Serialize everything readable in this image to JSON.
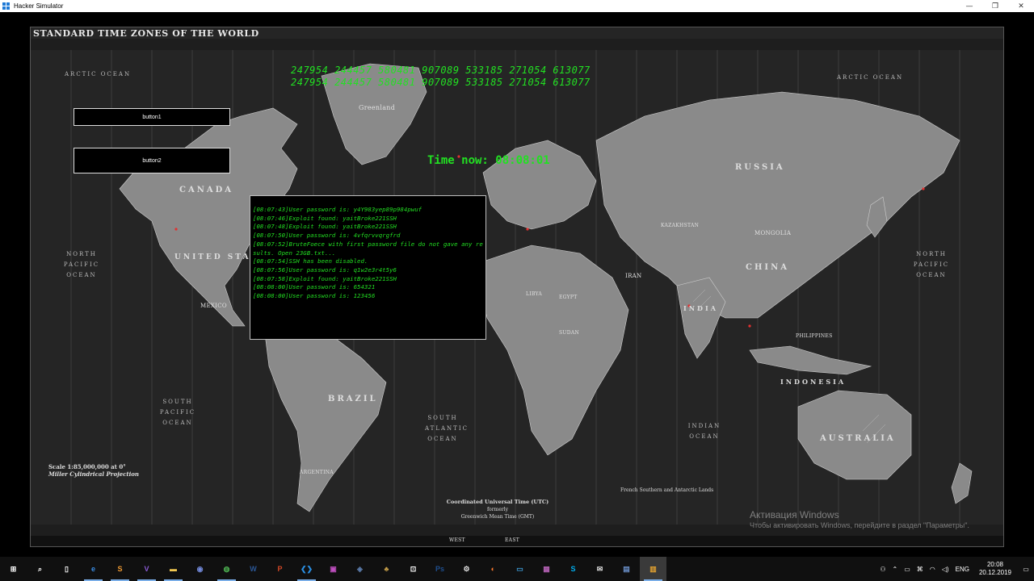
{
  "window": {
    "title": "Hacker Simulator",
    "minimize_glyph": "—",
    "maximize_glyph": "❐",
    "close_glyph": "✕"
  },
  "map": {
    "title": "STANDARD TIME ZONES OF THE WORLD",
    "labels": {
      "russia": "RUSSIA",
      "canada": "CANADA",
      "united_states": "UNITED STATES",
      "china": "CHINA",
      "india": "INDIA",
      "brazil": "BRAZIL",
      "australia": "AUSTRALIA",
      "indonesia": "INDONESIA",
      "mongolia": "MONGOLIA",
      "kazakhstan": "KAZAKHSTAN",
      "greenland": "Greenland",
      "mexico": "MEXICO",
      "argentina": "ARGENTINA",
      "libya": "LIBYA",
      "egypt": "EGYPT",
      "iran": "IRAN",
      "sudan": "SUDAN",
      "philippines": "PHILIPPINES"
    },
    "oceans": {
      "arctic_left": "ARCTIC OCEAN",
      "arctic_right": "ARCTIC OCEAN",
      "north_pacific_left": "NORTH PACIFIC OCEAN",
      "north_pacific_right": "NORTH PACIFIC OCEAN",
      "south_pacific": "SOUTH PACIFIC OCEAN",
      "south_atlantic": "SOUTH ATLANTIC OCEAN",
      "indian": "INDIAN OCEAN"
    },
    "scale_line1": "Scale 1:85,000,000 at 0°",
    "scale_line2": "Miller Cylindrical Projection",
    "utc_heading": "Coordinated Universal Time (UTC)",
    "utc_formerly": "formerly",
    "utc_gmt": "Greenwich Mean Time (GMT)",
    "fsa": "French Southern and Antarctic Lands",
    "bottom_west": "WEST",
    "bottom_east": "EAST"
  },
  "digits": {
    "row1": "247954 244457 580481 907089 533185 271054 613077",
    "row2": "247954 244457 580481 907089 533185 271054 613077"
  },
  "time_now": "Time now: 08:08:01",
  "buttons": {
    "button1": "button1",
    "button2": "button2"
  },
  "console": {
    "lines": [
      "[08:07:43]User password is: y4Y983yep89p984pwuf",
      "[08:07:46]Exploit found: yaitBroke221SSH",
      "[08:07:48]Exploit found: yaitBroke221SSH",
      "[08:07:50]User password is: 4vfqrvvqrgfrd",
      "[08:07:52]BruteFoece with first password file do not gave any results. Open 23GB.txt...",
      "[08:07:54]SSH has been disabled.",
      "[08:07:56]User password is: q1w2e3r4t5y6",
      "[08:07:58]Exploit found: yaitBroke221SSH",
      "[08:08:00]User password is: 654321",
      "[08:08:00]User password is: 123456"
    ]
  },
  "activation": {
    "line1": "Активация Windows",
    "line2": "Чтобы активировать Windows, перейдите в раздел \"Параметры\"."
  },
  "taskbar": {
    "items": [
      {
        "name": "start-button",
        "icon": "windows-icon",
        "glyph": "⊞",
        "color": "#ffffff"
      },
      {
        "name": "search-button",
        "icon": "search-icon",
        "glyph": "⌕",
        "color": "#ffffff"
      },
      {
        "name": "task-view-button",
        "icon": "task-view-icon",
        "glyph": "▯",
        "color": "#ffffff"
      },
      {
        "name": "edge-button",
        "icon": "edge-icon",
        "glyph": "e",
        "color": "#3b8ee6"
      },
      {
        "name": "sublime-button",
        "icon": "sublime-icon",
        "glyph": "S",
        "color": "#f19b33"
      },
      {
        "name": "visual-studio-button",
        "icon": "visual-studio-icon",
        "glyph": "V",
        "color": "#8b5bd6"
      },
      {
        "name": "explorer-button",
        "icon": "folder-icon",
        "glyph": "▬",
        "color": "#f3c851"
      },
      {
        "name": "discord-button",
        "icon": "discord-icon",
        "glyph": "◉",
        "color": "#7289da"
      },
      {
        "name": "chrome-button",
        "icon": "chrome-icon",
        "glyph": "◍",
        "color": "#4caf50"
      },
      {
        "name": "word-button",
        "icon": "word-icon",
        "glyph": "W",
        "color": "#2b5797"
      },
      {
        "name": "powerpoint-button",
        "icon": "powerpoint-icon",
        "glyph": "P",
        "color": "#d24726"
      },
      {
        "name": "vscode-button",
        "icon": "vscode-icon",
        "glyph": "❮❯",
        "color": "#2a8fe3"
      },
      {
        "name": "app1-button",
        "icon": "app-icon",
        "glyph": "▣",
        "color": "#c04fc0"
      },
      {
        "name": "app2-button",
        "icon": "app-icon",
        "glyph": "◈",
        "color": "#5a7aa8"
      },
      {
        "name": "app3-button",
        "icon": "app-icon",
        "glyph": "♣",
        "color": "#c9a14a"
      },
      {
        "name": "store-button",
        "icon": "store-icon",
        "glyph": "⊡",
        "color": "#ffffff"
      },
      {
        "name": "photoshop-button",
        "icon": "photoshop-icon",
        "glyph": "Ps",
        "color": "#1f4f8f"
      },
      {
        "name": "settings-button",
        "icon": "gear-icon",
        "glyph": "⚙",
        "color": "#dddddd"
      },
      {
        "name": "firefox-button",
        "icon": "firefox-icon",
        "glyph": "◐",
        "color": "#ff7b2e"
      },
      {
        "name": "app4-button",
        "icon": "app-icon",
        "glyph": "▭",
        "color": "#3d9bd6"
      },
      {
        "name": "app5-button",
        "icon": "app-icon",
        "glyph": "▦",
        "color": "#b05fb0"
      },
      {
        "name": "skype-button",
        "icon": "skype-icon",
        "glyph": "S",
        "color": "#00aff0"
      },
      {
        "name": "mail-button",
        "icon": "mail-icon",
        "glyph": "✉",
        "color": "#dddddd"
      },
      {
        "name": "app6-button",
        "icon": "app-icon",
        "glyph": "▤",
        "color": "#6a8fc8"
      },
      {
        "name": "hacker-simulator-button",
        "icon": "app-icon",
        "glyph": "▥",
        "color": "#e0a030"
      }
    ],
    "tray": {
      "people_glyph": "⚇",
      "chevron_glyph": "⌃",
      "battery_glyph": "▭",
      "network_glyph": "⌘",
      "wifi_glyph": "◠",
      "volume_glyph": "◁)",
      "language": "ENG",
      "time": "20:08",
      "date": "20.12.2019",
      "notification_glyph": "▭"
    }
  }
}
